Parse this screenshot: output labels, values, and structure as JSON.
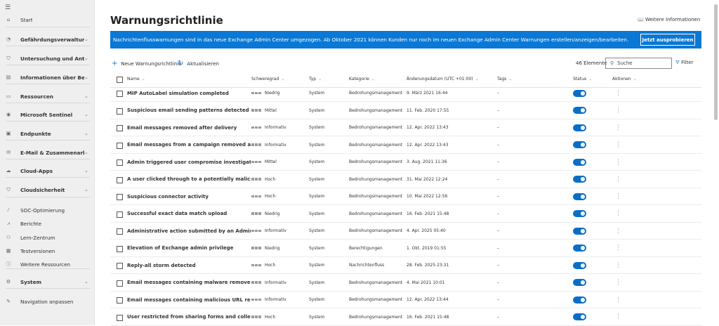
{
  "sidebar": {
    "items": [
      {
        "label": "Start",
        "icon": "home-icon",
        "expand": false
      },
      {
        "label": "Gefährdungsverwaltung",
        "icon": "threat-icon",
        "expand": true
      },
      {
        "label": "Untersuchung und Antwort",
        "icon": "shield-icon",
        "expand": true
      },
      {
        "label": "Informationen über Bedrohungen",
        "icon": "intel-icon",
        "expand": true
      },
      {
        "label": "Ressourcen",
        "icon": "assets-icon",
        "expand": true
      },
      {
        "label": "Microsoft Sentinel",
        "icon": "sentinel-icon",
        "expand": true
      },
      {
        "label": "Endpunkte",
        "icon": "endpoints-icon",
        "expand": true
      },
      {
        "label": "E-Mail & Zusammenarbeit",
        "icon": "mail-icon",
        "expand": true
      },
      {
        "label": "Cloud-Apps",
        "icon": "cloud-icon",
        "expand": true
      },
      {
        "label": "Cloudsicherheit",
        "icon": "cloud-shield-icon",
        "expand": true
      },
      {
        "label": "SOC-Optimierung",
        "icon": "wand-icon",
        "expand": false
      },
      {
        "label": "Berichte",
        "icon": "chart-icon",
        "expand": false
      },
      {
        "label": "Lern-Zentrum",
        "icon": "learn-icon",
        "expand": false
      },
      {
        "label": "Testversionen",
        "icon": "trial-icon",
        "expand": false
      },
      {
        "label": "Weitere Ressourcen",
        "icon": "info-icon",
        "expand": false
      },
      {
        "label": "System",
        "icon": "gear-icon",
        "expand": true
      },
      {
        "label": "Navigation anpassen",
        "icon": "pencil-icon",
        "expand": false
      }
    ]
  },
  "page": {
    "title": "Warnungsrichtlinie",
    "more_info": "Weitere Informationen"
  },
  "banner": {
    "text": "Nachrichtenflusswarnungen sind in das neue Exchange Admin Center umgezogen. Ab Oktober 2021 können Kunden nur noch im neuen Exchange Admin Center Warnungen erstellen/anzeigen/bearbeiten.",
    "button": "Jetzt ausprobieren",
    "color": "#0a78d4"
  },
  "toolbar": {
    "new": "Neue Warnungsrichtlinie",
    "refresh": "Aktualisieren",
    "count": "46 Elemente",
    "search_placeholder": "Suche",
    "filter": "Filter"
  },
  "table": {
    "headers": {
      "name": "Name",
      "severity": "Schweregrad",
      "type": "Typ",
      "category": "Kategorie",
      "date": "Änderungsdatum (UTC +01:00)",
      "tags": "Tags",
      "status": "Status",
      "actions": "Aktionen"
    },
    "rows": [
      {
        "name": "MIP AutoLabel simulation completed",
        "severity": "Niedrig",
        "type": "System",
        "category": "Bedrohungsmanagement",
        "date": "9. März 2021 16:44",
        "tags": "–",
        "enabled": true
      },
      {
        "name": "Suspicious email sending patterns detected",
        "severity": "Mittel",
        "type": "System",
        "category": "Bedrohungsmanagement",
        "date": "11. Feb. 2020 17:55",
        "tags": "–",
        "enabled": true
      },
      {
        "name": "Email messages removed after delivery",
        "severity": "Informativ",
        "type": "System",
        "category": "Bedrohungsmanagement",
        "date": "12. Apr. 2022 13:43",
        "tags": "–",
        "enabled": true
      },
      {
        "name": "Email messages from a campaign removed after delivery",
        "severity": "Informativ",
        "type": "System",
        "category": "Bedrohungsmanagement",
        "date": "12. Apr. 2022 13:43",
        "tags": "–",
        "enabled": true
      },
      {
        "name": "Admin triggered user compromise investigation",
        "severity": "Mittel",
        "type": "System",
        "category": "Bedrohungsmanagement",
        "date": "3. Aug. 2021 11:36",
        "tags": "–",
        "enabled": true
      },
      {
        "name": "A user clicked through to a potentially malicious URL",
        "severity": "Hoch",
        "type": "System",
        "category": "Bedrohungsmanagement",
        "date": "31. Mai 2022 12:24",
        "tags": "–",
        "enabled": true
      },
      {
        "name": "Suspicious connector activity",
        "severity": "Hoch",
        "type": "System",
        "category": "Bedrohungsmanagement",
        "date": "10. Mai 2022 12:56",
        "tags": "–",
        "enabled": true
      },
      {
        "name": "Successful exact data match upload",
        "severity": "Niedrig",
        "type": "System",
        "category": "Bedrohungsmanagement",
        "date": "16. Feb. 2021 15:48",
        "tags": "–",
        "enabled": true
      },
      {
        "name": "Administrative action submitted by an Administrator",
        "severity": "Informativ",
        "type": "System",
        "category": "Bedrohungsmanagement",
        "date": "4. Apr. 2025 05:40",
        "tags": "–",
        "enabled": true
      },
      {
        "name": "Elevation of Exchange admin privilege",
        "severity": "Niedrig",
        "type": "System",
        "category": "Berechtigungen",
        "date": "1. Okt. 2019 01:55",
        "tags": "–",
        "enabled": true
      },
      {
        "name": "Reply-all storm detected",
        "severity": "Hoch",
        "type": "System",
        "category": "Nachrichtenfluss",
        "date": "28. Feb. 2025 23:31",
        "tags": "–",
        "enabled": true
      },
      {
        "name": "Email messages containing malware removed after deli...",
        "severity": "Informativ",
        "type": "System",
        "category": "Bedrohungsmanagement",
        "date": "4. Mai 2021 10:01",
        "tags": "–",
        "enabled": true
      },
      {
        "name": "Email messages containing malicious URL removed afte...",
        "severity": "Informativ",
        "type": "System",
        "category": "Bedrohungsmanagement",
        "date": "12. Apr. 2022 13:44",
        "tags": "–",
        "enabled": true
      },
      {
        "name": "User restricted from sharing forms and collecting respo...",
        "severity": "Hoch",
        "type": "System",
        "category": "Bedrohungsmanagement",
        "date": "16. Feb. 2021 15:48",
        "tags": "–",
        "enabled": true
      }
    ]
  }
}
